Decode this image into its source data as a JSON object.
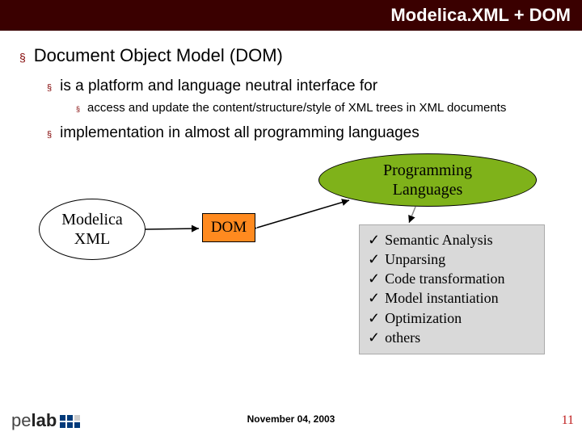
{
  "header": {
    "title": "Modelica.XML + DOM"
  },
  "body": {
    "h1": "Document Object Model (DOM)",
    "h2a": "is a platform and language neutral interface for",
    "h3a": "access and update the content/structure/style of XML trees in XML documents",
    "h2b": "implementation in almost all programming languages"
  },
  "diagram": {
    "modelica": "Modelica\nXML",
    "dom": "DOM",
    "proglang": "Programming\nLanguages",
    "checks": [
      "Semantic Analysis",
      "Unparsing",
      "Code transformation",
      "Model instantiation",
      "Optimization",
      "others"
    ],
    "checkmark": "✓"
  },
  "footer": {
    "logo_pe": "pe",
    "logo_lab": "lab",
    "date": "November 04, 2003",
    "page": "11"
  }
}
